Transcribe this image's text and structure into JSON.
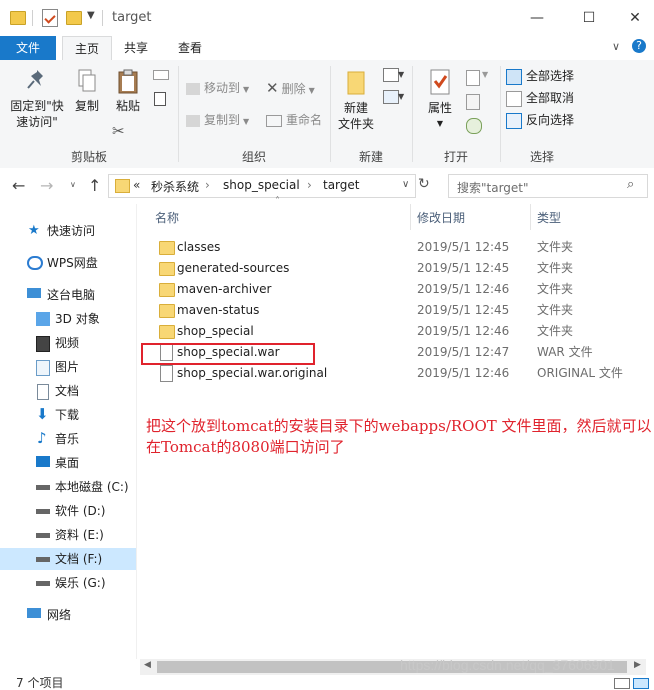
{
  "window": {
    "title": "target",
    "minimize": "—",
    "maximize": "☐",
    "close": "✕"
  },
  "tabs": {
    "file": "文件",
    "home": "主页",
    "share": "共享",
    "view": "查看"
  },
  "ribbon": {
    "clipboard": {
      "label": "剪贴板",
      "pin_line1": "固定到\"快",
      "pin_line2": "速访问\"",
      "copy": "复制",
      "paste": "粘贴"
    },
    "organize": {
      "label": "组织",
      "move_to": "移动到",
      "copy_to": "复制到",
      "delete": "删除",
      "rename": "重命名"
    },
    "new": {
      "label": "新建",
      "new_folder_line1": "新建",
      "new_folder_line2": "文件夹"
    },
    "open": {
      "label": "打开",
      "properties": "属性"
    },
    "select": {
      "label": "选择",
      "select_all": "全部选择",
      "select_none": "全部取消",
      "invert": "反向选择"
    }
  },
  "address": {
    "breadcrumb": [
      "«",
      "秒杀系统",
      "shop_special",
      "target"
    ],
    "search_placeholder": "搜索\"target\""
  },
  "nav": {
    "items": [
      {
        "label": "快速访问"
      },
      {
        "label": "WPS网盘"
      },
      {
        "label": "这台电脑"
      },
      {
        "label": "3D 对象"
      },
      {
        "label": "视频"
      },
      {
        "label": "图片"
      },
      {
        "label": "文档"
      },
      {
        "label": "下载"
      },
      {
        "label": "音乐"
      },
      {
        "label": "桌面"
      },
      {
        "label": "本地磁盘 (C:)"
      },
      {
        "label": "软件 (D:)"
      },
      {
        "label": "资料 (E:)"
      },
      {
        "label": "文档 (F:)"
      },
      {
        "label": "娱乐 (G:)"
      },
      {
        "label": "网络"
      }
    ]
  },
  "columns": {
    "name": "名称",
    "date": "修改日期",
    "type": "类型"
  },
  "files": [
    {
      "name": "classes",
      "date": "2019/5/1 12:45",
      "type": "文件夹"
    },
    {
      "name": "generated-sources",
      "date": "2019/5/1 12:45",
      "type": "文件夹"
    },
    {
      "name": "maven-archiver",
      "date": "2019/5/1 12:46",
      "type": "文件夹"
    },
    {
      "name": "maven-status",
      "date": "2019/5/1 12:45",
      "type": "文件夹"
    },
    {
      "name": "shop_special",
      "date": "2019/5/1 12:46",
      "type": "文件夹"
    },
    {
      "name": "shop_special.war",
      "date": "2019/5/1 12:47",
      "type": "WAR 文件"
    },
    {
      "name": "shop_special.war.original",
      "date": "2019/5/1 12:46",
      "type": "ORIGINAL 文件"
    }
  ],
  "annotation": {
    "line1": "把这个放到tomcat的安装目录下的webapps/ROOT 文件里面，然后就可以",
    "line2": "在Tomcat的8080端口访问了"
  },
  "status": {
    "count": "7 个项目"
  },
  "watermark": "https://blog.csdn.net/qq_37606901",
  "colors": {
    "accent": "#1979ca",
    "annotation": "#e0232d",
    "selection": "#cce8ff"
  }
}
